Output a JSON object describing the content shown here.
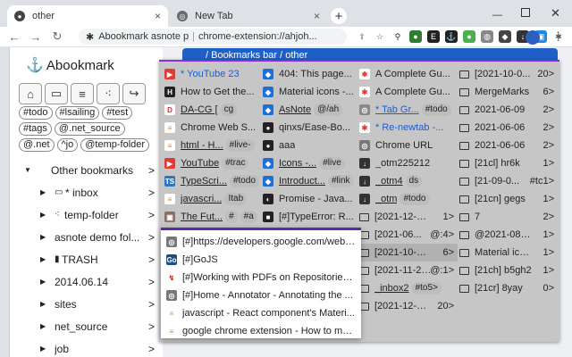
{
  "browser": {
    "tabs": [
      {
        "title": "other",
        "active": true
      },
      {
        "title": "New Tab",
        "active": false
      }
    ],
    "url_part1": "Abookmark asnote p",
    "url_part2": "chrome-extension://ahjoh...",
    "new_tab_symbol": "+",
    "close_symbol": "×"
  },
  "popup": {
    "title": "Abookmark",
    "toolbar_icons": [
      "home-icon",
      "inbox-icon",
      "sort-icon",
      "dots-icon",
      "share-icon"
    ],
    "tags": [
      "#todo",
      "#lsailing",
      "#test",
      "#tags",
      "@.net_source",
      "@.net",
      "^jo",
      "@temp-folder"
    ],
    "tree": [
      {
        "label": "Other bookmarks",
        "depth": 0,
        "expanded": true,
        "icon": "none"
      },
      {
        "label": "* inbox",
        "depth": 1,
        "expanded": false,
        "icon": "inbox"
      },
      {
        "label": "temp-folder",
        "depth": 1,
        "expanded": false,
        "icon": "dots"
      },
      {
        "label": "asnote demo fol...",
        "depth": 1,
        "expanded": false,
        "icon": "none"
      },
      {
        "label": "TRASH",
        "depth": 1,
        "expanded": false,
        "icon": "trash"
      },
      {
        "label": "2014.06.14",
        "depth": 1,
        "expanded": false,
        "icon": "none"
      },
      {
        "label": "sites",
        "depth": 1,
        "expanded": false,
        "icon": "none"
      },
      {
        "label": "net_source",
        "depth": 1,
        "expanded": false,
        "icon": "none"
      },
      {
        "label": "job",
        "depth": 1,
        "expanded": false,
        "icon": "none"
      }
    ],
    "tree_arrow": ">"
  },
  "main": {
    "header": "/ Bookmarks bar / other"
  },
  "grid": {
    "col1": [
      {
        "text": "* YouTube 23",
        "icon": "yt",
        "link": true,
        "hl": false
      },
      {
        "text": "How to Get the...",
        "icon": "htb",
        "link": false,
        "hl": false
      },
      {
        "text": "DA-CG [",
        "icon": "d",
        "link": false,
        "u": true,
        "chip": "cg"
      },
      {
        "text": "Chrome Web S...",
        "icon": "so",
        "link": false
      },
      {
        "text": "html - H...",
        "icon": "so",
        "link": false,
        "u": true,
        "chip": "#live-"
      },
      {
        "text": "YouTube",
        "icon": "yt",
        "link": false,
        "u": true,
        "chip": "#trac"
      },
      {
        "text": "TypeScri...",
        "icon": "ts",
        "link": false,
        "u": true,
        "chip": "#todo"
      },
      {
        "text": "javascri...",
        "icon": "so",
        "link": false,
        "u": true,
        "chip": "Itab"
      },
      {
        "text": "The Fut...",
        "icon": "img",
        "link": false,
        "u": true,
        "chip": "#",
        "chip2": "#a"
      }
    ],
    "col2": [
      {
        "text": "404: This page...",
        "icon": "blue",
        "link": false
      },
      {
        "text": "Material icons -...",
        "icon": "blue",
        "link": false
      },
      {
        "text": "AsNote",
        "icon": "blue",
        "link": false,
        "u": true,
        "chip": "@/ah"
      },
      {
        "text": "qinxs/Ease-Bo...",
        "icon": "gh",
        "link": false
      },
      {
        "text": "aaa",
        "icon": "gh",
        "link": false
      },
      {
        "text": "Icons -...",
        "icon": "blue",
        "link": false,
        "u": true,
        "chip": "#live"
      },
      {
        "text": "Introduct...",
        "icon": "blue",
        "link": false,
        "u": true,
        "chip": "#link"
      },
      {
        "text": "Promise - Java...",
        "icon": "mdn",
        "link": false
      },
      {
        "text": "[#]TypeError: R...",
        "icon": "sq",
        "link": false
      }
    ],
    "col3": [
      {
        "text": "A Complete Gu...",
        "icon": "star",
        "link": false
      },
      {
        "text": "A Complete Gu...",
        "icon": "star",
        "link": false
      },
      {
        "text": "* Tab Gr...",
        "icon": "ext",
        "link": true,
        "u": true,
        "chip": "#todo"
      },
      {
        "text": "* Re-newtab -...",
        "icon": "star",
        "link": true
      },
      {
        "text": "Chrome URL",
        "icon": "chrome",
        "link": false
      },
      {
        "text": "_otm225212",
        "icon": "dl",
        "link": false
      },
      {
        "text": "_otm4",
        "icon": "dl",
        "link": false,
        "u": true,
        "chip": "ds"
      },
      {
        "text": "_otm",
        "icon": "dl",
        "link": false,
        "u": true,
        "chip": "#todo"
      },
      {
        "text": "[2021-12-08]...",
        "icon": "folder",
        "link": false,
        "cnt": "1>"
      },
      {
        "text": "[2021-06...",
        "icon": "folder",
        "link": false,
        "cnt": "@:4>"
      },
      {
        "text": "[2021-10-09...",
        "icon": "folder",
        "link": false,
        "cnt": "6>",
        "hl": true
      },
      {
        "text": "[2021-11-21]...",
        "icon": "folder",
        "link": false,
        "cnt": "@:1>"
      },
      {
        "text": "_inbox2",
        "icon": "folder",
        "link": false,
        "u": true,
        "chip": "#to5>"
      },
      {
        "text": "[2021-12-06]...",
        "icon": "folder",
        "link": false,
        "cnt": "20>"
      }
    ],
    "col4": [
      {
        "text": "[2021-10-0...",
        "cnt": "20>"
      },
      {
        "text": "MergeMarks",
        "cnt": "6>"
      },
      {
        "text": "2021-06-09",
        "cnt": "2>"
      },
      {
        "text": "2021-06-06",
        "cnt": "2>"
      },
      {
        "text": "2021-06-06",
        "cnt": "2>"
      },
      {
        "text": "[21cl] hr6k",
        "cnt": "1>"
      },
      {
        "text": "[21-09-0...",
        "cnt": "#tc1>"
      },
      {
        "text": "[21cn] gegs",
        "cnt": "1>"
      },
      {
        "text": "7",
        "cnt": "2>"
      },
      {
        "text": "@2021-08-2...",
        "cnt": "1>"
      },
      {
        "text": "Material icon...",
        "cnt": "1>"
      },
      {
        "text": "[21ch] b5gh2",
        "cnt": "1>"
      },
      {
        "text": "[21cr] 8yay",
        "cnt": "0>"
      }
    ]
  },
  "results": [
    {
      "text": "[#]https://developers.google.com/web/...",
      "icon": "chrome"
    },
    {
      "text": "[#]GoJS",
      "icon": "go"
    },
    {
      "text": "[#]Working with PDFs on Repositories...",
      "icon": "pdf"
    },
    {
      "text": "[#]Home - Annotator - Annotating the ...",
      "icon": "chrome"
    },
    {
      "text": "javascript - React component's Materi...",
      "icon": "so"
    },
    {
      "text": "google chrome extension - How to mo...",
      "icon": "so"
    }
  ],
  "colors": {
    "accent_purple": "#8c2ed6",
    "results_border": "#5a2ca8",
    "main_bar": "#1f5fc6",
    "link": "#1a5fd1",
    "grid_bg": "#c6c6c6"
  }
}
